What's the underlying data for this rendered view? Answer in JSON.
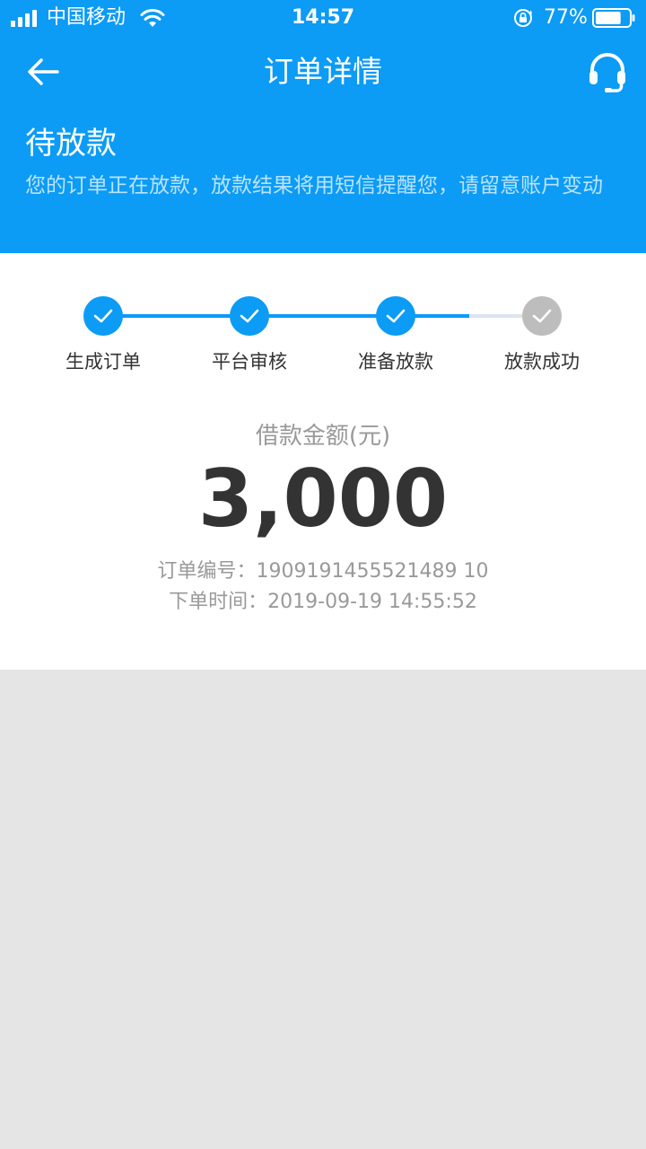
{
  "status_bar": {
    "carrier": "中国移动",
    "time": "14:57",
    "battery": "77%",
    "battery_level": 0.77
  },
  "nav": {
    "title": "订单详情",
    "back_icon": "arrow-left-icon",
    "service_icon": "headset-icon"
  },
  "order_state": {
    "title": "待放款",
    "description": "您的订单正在放款，放款结果将用短信提醒您，请留意账户变动"
  },
  "progress": {
    "steps": [
      {
        "label": "生成订单",
        "done": true
      },
      {
        "label": "平台审核",
        "done": true
      },
      {
        "label": "准备放款",
        "done": true
      },
      {
        "label": "放款成功",
        "done": false
      }
    ]
  },
  "loan": {
    "amount_label": "借款金额(元)",
    "amount": "3,000"
  },
  "order_info": {
    "number_label": "订单编号：",
    "number": "1909191455521489 10",
    "time_label": "下单时间：",
    "time": "2019-09-19 14:55:52"
  },
  "colors": {
    "primary": "#0c9bf5",
    "pending": "#bdbdbd",
    "background": "#e5e5e5"
  }
}
